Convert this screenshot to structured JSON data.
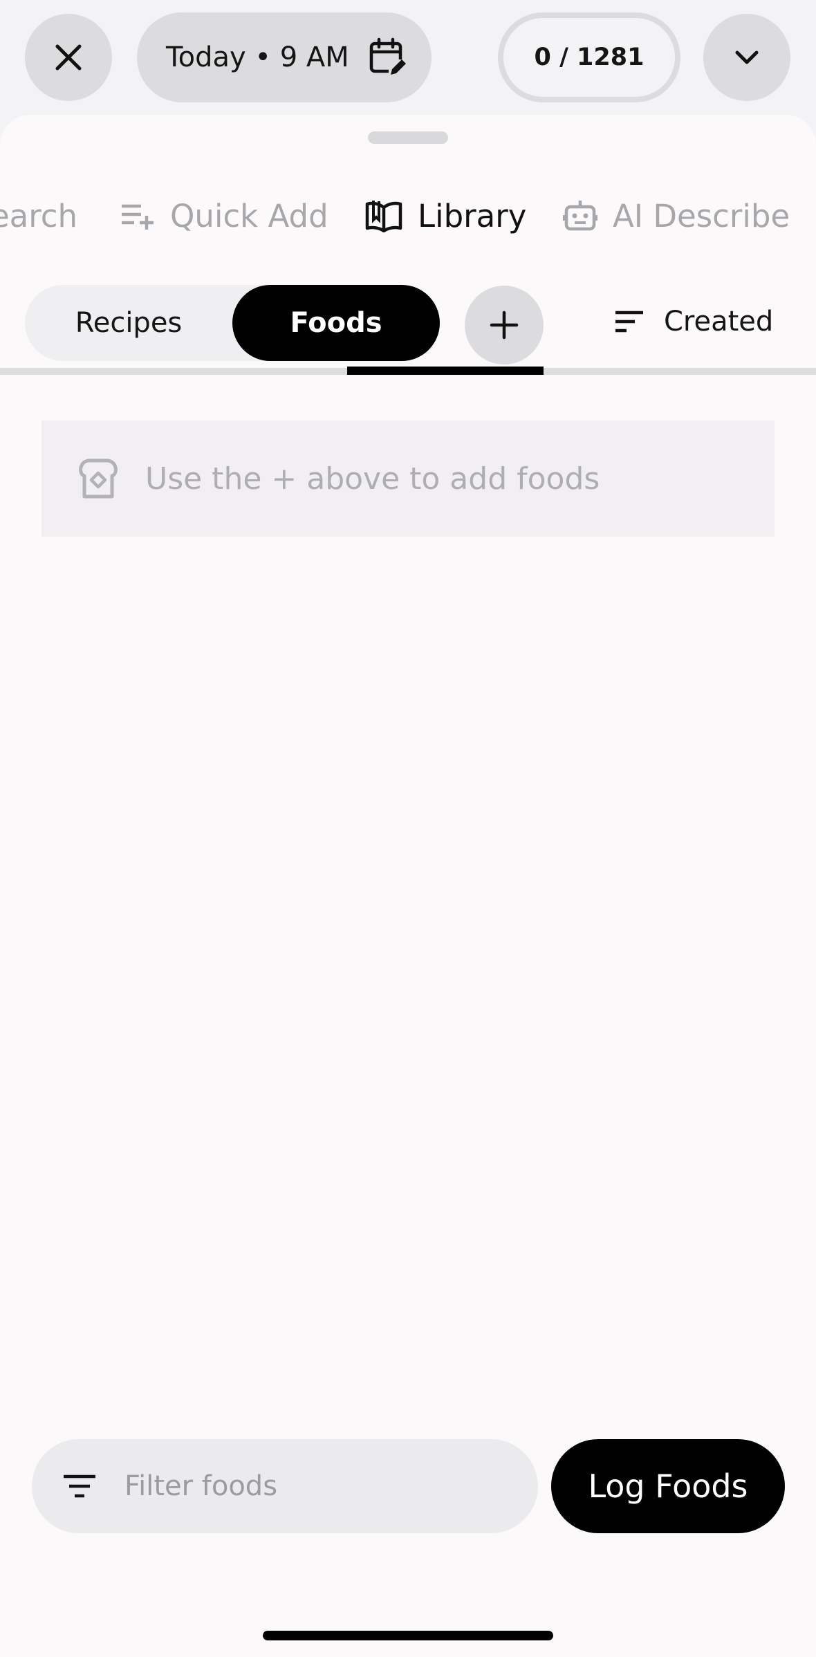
{
  "header": {
    "date_label": "Today • 9 AM",
    "counter": "0 / 1281",
    "icons": {
      "close": "close-icon",
      "calendar": "calendar-edit-icon",
      "collapse": "chevron-down-icon"
    }
  },
  "tabs": [
    {
      "label": "Search",
      "visible_text": "earch",
      "icon": "search-icon"
    },
    {
      "label": "Quick Add",
      "icon": "playlist-add-icon"
    },
    {
      "label": "Library",
      "icon": "book-open-icon",
      "active": true
    },
    {
      "label": "AI Describe",
      "icon": "robot-icon"
    }
  ],
  "library": {
    "segments": [
      "Recipes",
      "Foods"
    ],
    "selected_segment": "Foods",
    "add_icon": "plus-icon",
    "sort_label": "Created",
    "sort_icon": "sort-icon",
    "empty_message": "Use the + above to add foods",
    "empty_icon": "toast-bread-icon"
  },
  "footer": {
    "filter_placeholder": "Filter foods",
    "filter_value": "",
    "filter_icon": "filter-icon",
    "log_button": "Log Foods"
  },
  "colors": {
    "background": "#f3f2f5",
    "sheet": "#fcf9fb",
    "pill": "#dcdbde",
    "accent": "#000000",
    "muted_text": "#a7a6aa"
  }
}
